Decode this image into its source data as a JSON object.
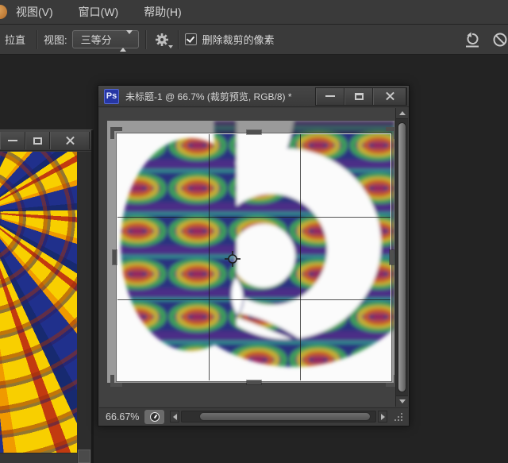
{
  "menu_bar": {
    "items": [
      {
        "label": "视图(V)"
      },
      {
        "label": "窗口(W)"
      },
      {
        "label": "帮助(H)"
      }
    ]
  },
  "options_bar": {
    "straighten_label": "拉直",
    "view_label": "视图:",
    "view_value": "三等分",
    "delete_pixels_label": "删除裁剪的像素",
    "delete_pixels_checked": true,
    "icons": {
      "gear": "gear-icon",
      "reset": "counterclockwise-arrow-with-underline",
      "cancel": "circle-slash"
    }
  },
  "doc_window": {
    "badge": "Ps",
    "title": "未标题-1 @ 66.7% (裁剪预览, RGB/8) *",
    "buttons": [
      "minimize",
      "maximize",
      "close"
    ],
    "crop": {
      "grid": "rule-of-thirds",
      "preview": "裁剪预览"
    },
    "status": {
      "zoom_level": "66.67%"
    }
  },
  "left_window": {
    "buttons": [
      "minimize",
      "maximize",
      "close"
    ]
  },
  "colors": {
    "app_background": "#232323",
    "panel": "#3a3a3a",
    "pasteboard": "#414141",
    "ps_badge_blue": "#2636a4",
    "moire_navy": "#2c3380",
    "moire_purple": "#4c2d87",
    "moire_teal": "#2f9090",
    "moire_green": "#3f9f58",
    "moire_yellow": "#c9b02f",
    "moire_orange": "#c4552a",
    "moire_magenta": "#97265f",
    "left_art_yellow": "#f8cf00",
    "left_art_blue": "#20308c",
    "left_art_orange": "#f09a00"
  }
}
